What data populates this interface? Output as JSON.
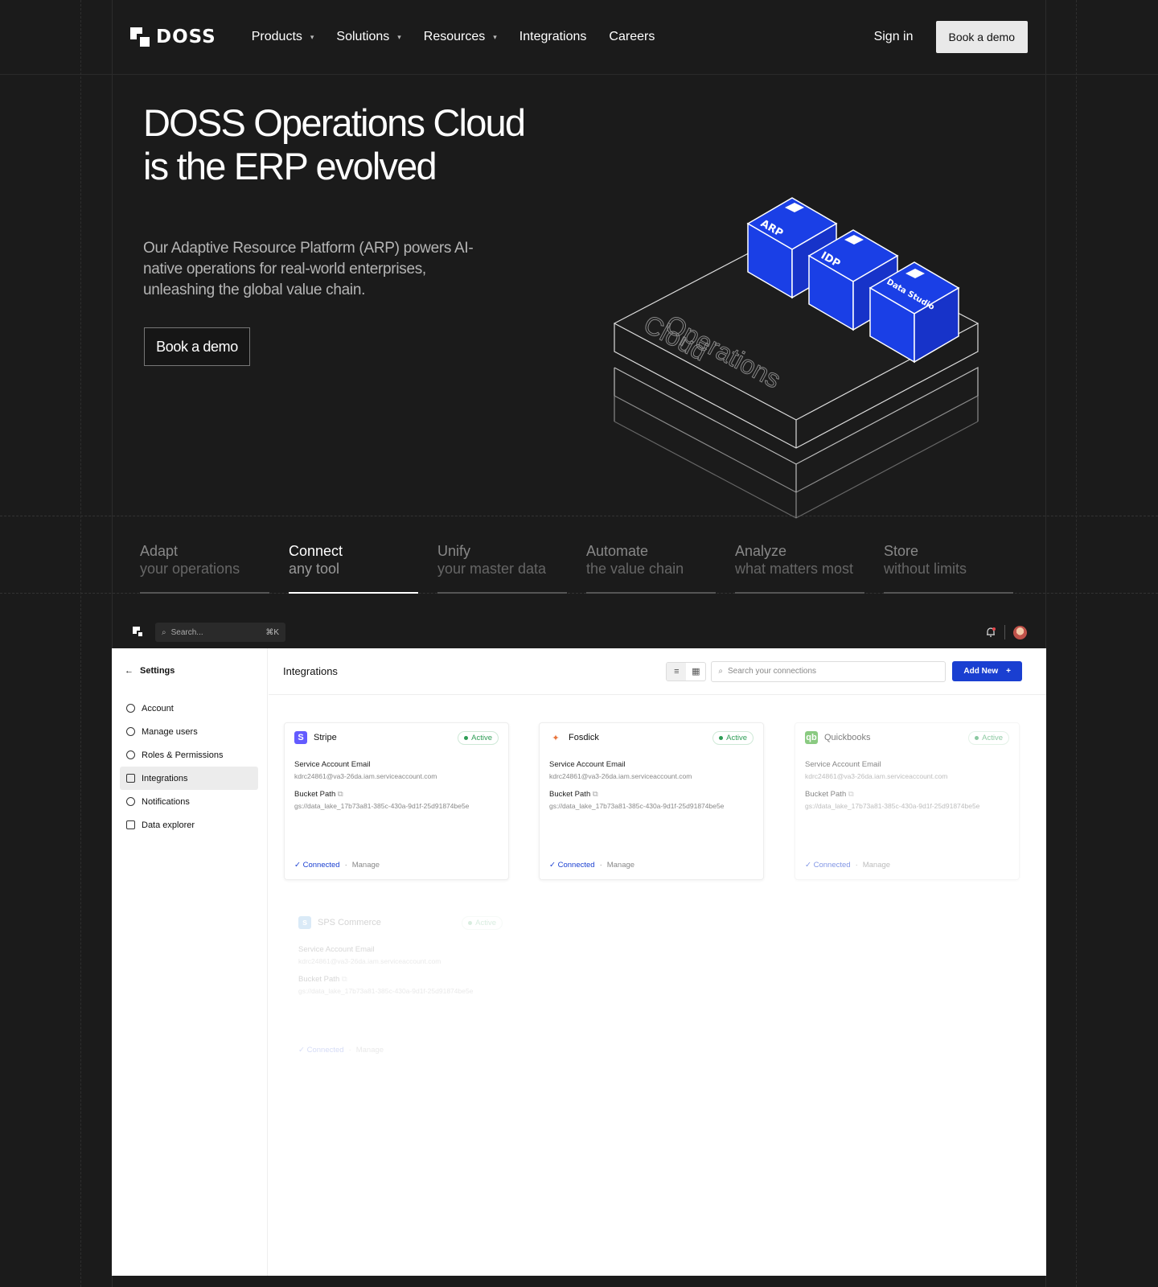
{
  "nav": {
    "logo_text": "DOSS",
    "links": [
      "Products",
      "Solutions",
      "Resources",
      "Integrations",
      "Careers"
    ],
    "signin": "Sign in",
    "cta": "Book a demo"
  },
  "hero": {
    "title_line1": "DOSS Operations Cloud",
    "title_line2": "is the ERP evolved",
    "subtitle": "Our Adaptive Resource Platform (ARP) powers AI-native operations for real-world enterprises, unleashing the global value chain.",
    "cta": "Book a demo",
    "illustration": {
      "base_label_1": "Operations",
      "base_label_2": "Cloud",
      "cube_labels": [
        "ARP",
        "IDP",
        "Data Studio"
      ],
      "cube_color": "#1a3fe6"
    }
  },
  "tabs": [
    {
      "title": "Adapt",
      "sub": "your operations"
    },
    {
      "title": "Connect",
      "sub": "any tool"
    },
    {
      "title": "Unify",
      "sub": "your master data"
    },
    {
      "title": "Automate",
      "sub": "the value chain"
    },
    {
      "title": "Analyze",
      "sub": "what matters most"
    },
    {
      "title": "Store",
      "sub": "without limits"
    }
  ],
  "app": {
    "search_placeholder": "Search...",
    "search_shortcut": "⌘K",
    "sidebar": {
      "back_label": "Settings",
      "items": [
        "Account",
        "Manage users",
        "Roles & Permissions",
        "Integrations",
        "Notifications",
        "Data explorer"
      ]
    },
    "main": {
      "title": "Integrations",
      "search_placeholder": "Search your connections",
      "add_button": "Add New"
    },
    "cards": [
      {
        "name": "Stripe",
        "status": "Active",
        "email_label": "Service Account Email",
        "email": "kdrc24861@va3-26da.iam.serviceaccount.com",
        "path_label": "Bucket Path",
        "path": "gs://data_lake_17b73a81-385c-430a-9d1f-25d91874be5e",
        "connected": "Connected",
        "manage": "Manage",
        "color": "#635bff"
      },
      {
        "name": "Fosdick",
        "status": "Active",
        "email_label": "Service Account Email",
        "email": "kdrc24861@va3-26da.iam.serviceaccount.com",
        "path_label": "Bucket Path",
        "path": "gs://data_lake_17b73a81-385c-430a-9d1f-25d91874be5e",
        "connected": "Connected",
        "manage": "Manage",
        "color": "#e8743b"
      },
      {
        "name": "Quickbooks",
        "status": "Active",
        "email_label": "Service Account Email",
        "email": "kdrc24861@va3-26da.iam.serviceaccount.com",
        "path_label": "Bucket Path",
        "path": "gs://data_lake_17b73a81-385c-430a-9d1f-25d91874be5e",
        "connected": "Connected",
        "manage": "Manage",
        "color": "#2ca01c"
      },
      {
        "name": "SPS Commerce",
        "status": "Active",
        "email_label": "Service Account Email",
        "email": "kdrc24861@va3-26da.iam.serviceaccount.com",
        "path_label": "Bucket Path",
        "path": "gs://data_lake_17b73a81-385c-430a-9d1f-25d91874be5e",
        "connected": "Connected",
        "manage": "Manage",
        "color": "#3a8fd6"
      }
    ]
  }
}
